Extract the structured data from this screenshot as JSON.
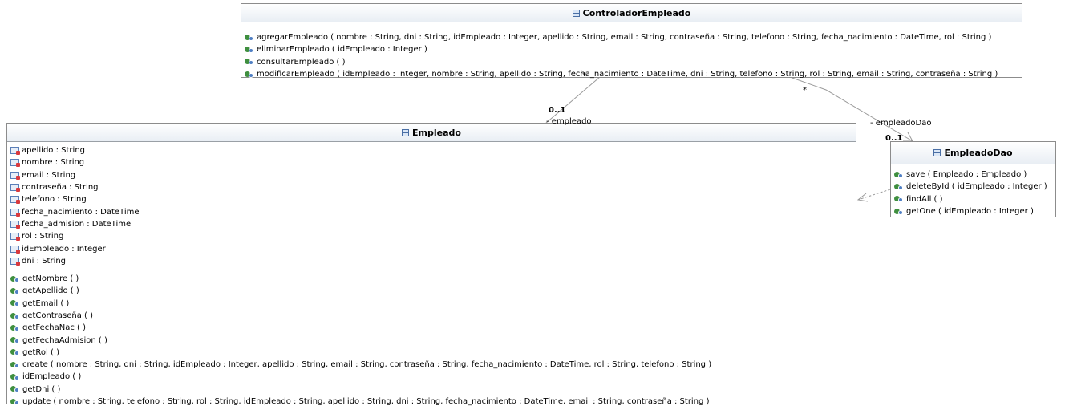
{
  "controlador": {
    "name": "ControladorEmpleado",
    "operations": [
      "agregarEmpleado ( nombre : String, dni : String, idEmpleado : Integer, apellido : String, email : String, contraseña : String, telefono : String, fecha_nacimiento : DateTime, rol : String )",
      "eliminarEmpleado ( idEmpleado : Integer )",
      "consultarEmpleado ( )",
      "modificarEmpleado ( idEmpleado : Integer, nombre : String, apellido : String, fecha_nacimiento : DateTime, dni : String, telefono : String, rol : String, email : String, contraseña : String )"
    ]
  },
  "empleado": {
    "name": "Empleado",
    "attributes": [
      "apellido : String",
      "nombre : String",
      "email : String",
      "contraseña : String",
      "telefono : String",
      "fecha_nacimiento : DateTime",
      "fecha_admision : DateTime",
      "rol : String",
      "idEmpleado : Integer",
      "dni : String"
    ],
    "operations": [
      "getNombre ( )",
      "getApellido ( )",
      "getEmail ( )",
      "getContraseña ( )",
      "getFechaNac ( )",
      "getFechaAdmision ( )",
      "getRol ( )",
      "create ( nombre : String, dni : String, idEmpleado : Integer, apellido : String, email : String, contraseña : String, fecha_nacimiento : DateTime, rol : String, telefono : String )",
      "idEmpleado ( )",
      "getDni ( )",
      "update ( nombre : String, telefono : String, rol : String, idEmpleado : String, apellido : String, dni : String, fecha_nacimiento : DateTime, email : String, contraseña : String )"
    ]
  },
  "empleadoDao": {
    "name": "EmpleadoDao",
    "operations": [
      "save ( Empleado : Empleado )",
      "deleteById ( idEmpleado : Integer )",
      "findAll ( )",
      "getOne ( idEmpleado : Integer )"
    ]
  },
  "associations": {
    "empleado": {
      "source_mult": "*",
      "target_mult": "0..1",
      "role": "- empleado"
    },
    "empleadoDao": {
      "source_mult": "*",
      "target_mult": "0..1",
      "role": "- empleadoDao"
    }
  },
  "colors": {
    "line": "#9a9a9a",
    "border": "#8c8c8c",
    "header_bottom": "#e9eef4"
  }
}
